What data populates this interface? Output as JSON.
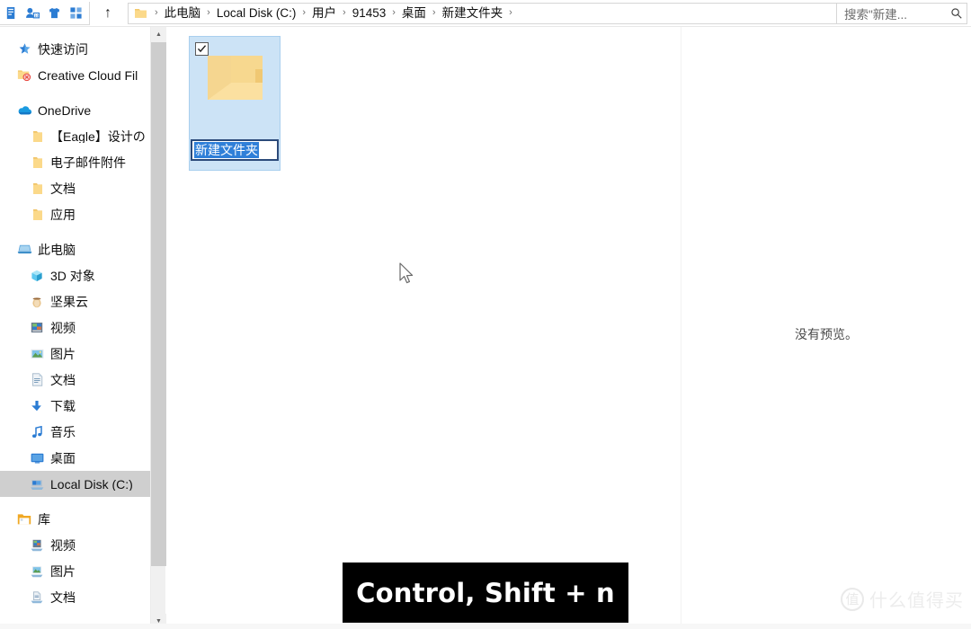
{
  "window": {
    "title": "新建文件夹",
    "quick_access_toolbar": [
      {
        "name": "properties-icon",
        "label": "属性"
      },
      {
        "name": "new-folder-icon",
        "label": "新建文件夹"
      },
      {
        "name": "customize-icon",
        "label": "自定义"
      },
      {
        "name": "view-icon",
        "label": "视图"
      }
    ],
    "up_button_label": "↑"
  },
  "address_bar": {
    "folder_icon": "folder-icon",
    "crumbs": [
      "此电脑",
      "Local Disk (C:)",
      "用户",
      "91453",
      "桌面",
      "新建文件夹"
    ],
    "separator": "›",
    "history_chevron": "⌄",
    "refresh_icon": "↻"
  },
  "search": {
    "placeholder": "搜索\"新建...",
    "icon": "search-icon"
  },
  "sidebar": {
    "sections": [
      {
        "items": [
          {
            "label": "快速访问",
            "icon": "star-pin-icon",
            "level": 0,
            "selected": false
          },
          {
            "label": "Creative Cloud Fil",
            "icon": "creative-cloud-folder-icon",
            "level": 0,
            "selected": false
          }
        ]
      },
      {
        "items": [
          {
            "label": "OneDrive",
            "icon": "onedrive-cloud-icon",
            "level": 0,
            "selected": false
          },
          {
            "label": "【Eagle】设计の",
            "icon": "folder-icon",
            "level": 1,
            "selected": false
          },
          {
            "label": "电子邮件附件",
            "icon": "folder-icon",
            "level": 1,
            "selected": false
          },
          {
            "label": "文档",
            "icon": "folder-icon",
            "level": 1,
            "selected": false
          },
          {
            "label": "应用",
            "icon": "folder-icon",
            "level": 1,
            "selected": false
          }
        ]
      },
      {
        "items": [
          {
            "label": "此电脑",
            "icon": "this-pc-icon",
            "level": 0,
            "selected": false
          },
          {
            "label": "3D 对象",
            "icon": "3d-objects-icon",
            "level": 1,
            "selected": false
          },
          {
            "label": "坚果云",
            "icon": "nutstore-icon",
            "level": 1,
            "selected": false
          },
          {
            "label": "视频",
            "icon": "videos-icon",
            "level": 1,
            "selected": false
          },
          {
            "label": "图片",
            "icon": "pictures-icon",
            "level": 1,
            "selected": false
          },
          {
            "label": "文档",
            "icon": "documents-icon",
            "level": 1,
            "selected": false
          },
          {
            "label": "下载",
            "icon": "downloads-icon",
            "level": 1,
            "selected": false
          },
          {
            "label": "音乐",
            "icon": "music-icon",
            "level": 1,
            "selected": false
          },
          {
            "label": "桌面",
            "icon": "desktop-icon",
            "level": 1,
            "selected": false
          },
          {
            "label": "Local Disk (C:)",
            "icon": "local-disk-icon",
            "level": 1,
            "selected": true
          }
        ]
      },
      {
        "items": [
          {
            "label": "库",
            "icon": "libraries-icon",
            "level": 0,
            "selected": false
          },
          {
            "label": "视频",
            "icon": "library-videos-icon",
            "level": 1,
            "selected": false
          },
          {
            "label": "图片",
            "icon": "library-pictures-icon",
            "level": 1,
            "selected": false
          },
          {
            "label": "文档",
            "icon": "library-documents-icon",
            "level": 1,
            "selected": false
          }
        ]
      }
    ]
  },
  "content": {
    "items": [
      {
        "name": "新建文件夹",
        "icon": "folder-icon",
        "selected": true,
        "checked": true,
        "renaming": true
      }
    ]
  },
  "preview_pane": {
    "message": "没有预览。"
  },
  "caption": {
    "text": "Control, Shift + n"
  },
  "watermark": {
    "mark": "值",
    "text": "什么值得买"
  },
  "colors": {
    "selection_blue": "#cce3f6",
    "selection_border": "#a9cfee",
    "text_highlight": "#2f7fd8",
    "sidebar_selected": "#cfcfcf",
    "folder_yellow": "#f5d37e",
    "accent_blue": "#2b7cd3",
    "caption_bg": "#000000"
  }
}
